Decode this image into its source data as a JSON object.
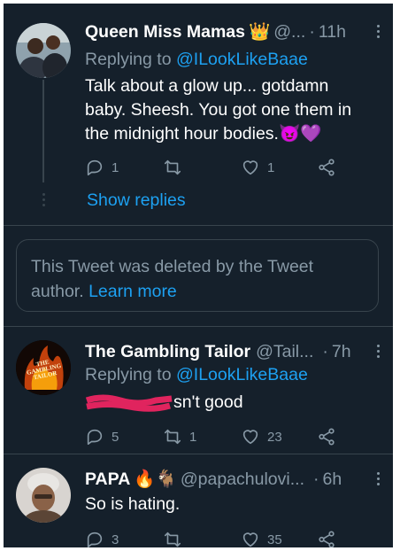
{
  "tweets": [
    {
      "name": "Queen Miss Mamas",
      "badge": "👑",
      "handle": "@...",
      "time": "11h",
      "reply_prefix": "Replying to",
      "reply_mention": "@ILookLikeBaae",
      "text": "Talk about a glow up... gotdamn baby. Sheesh. You got one them in the midnight hour bodies.😈💜",
      "replies": "1",
      "retweets": "",
      "likes": "1"
    },
    {
      "name": "The Gambling Tailor",
      "handle": "@Tail...",
      "time": "7h",
      "reply_prefix": "Replying to",
      "reply_mention": "@ILookLikeBaae",
      "text": "sn't good",
      "replies": "5",
      "retweets": "1",
      "likes": "23",
      "avatar_text": "THE GAMBLING TAILOR"
    },
    {
      "name": "PAPA",
      "badge": "🔥🐐",
      "handle": "@papachulovi...",
      "time": "6h",
      "text": "So is hating.",
      "replies": "3",
      "retweets": "",
      "likes": "35"
    }
  ],
  "show_replies": "Show replies",
  "deleted_notice": {
    "text": "This Tweet was deleted by the Tweet author.",
    "link": "Learn more"
  },
  "separator": "·",
  "colors": {
    "background": "#15202b",
    "accent": "#1da1f2",
    "muted": "#8899a6",
    "border": "#38444d",
    "scribble": "#e0245e"
  },
  "icons": [
    "reply-icon",
    "retweet-icon",
    "like-icon",
    "share-icon",
    "more-icon",
    "crown-emoji"
  ]
}
